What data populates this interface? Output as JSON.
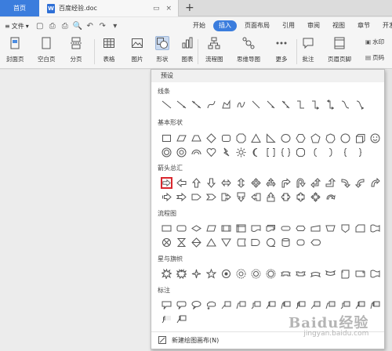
{
  "tabs": {
    "home": "首页",
    "doc": "百度经验.doc",
    "add": "+"
  },
  "menubar": {
    "file": "文件",
    "items": [
      {
        "label": "开始",
        "active": false
      },
      {
        "label": "插入",
        "active": true
      },
      {
        "label": "页面布局",
        "active": false
      },
      {
        "label": "引用",
        "active": false
      },
      {
        "label": "审阅",
        "active": false
      },
      {
        "label": "视图",
        "active": false
      },
      {
        "label": "章节",
        "active": false
      },
      {
        "label": "开发工具",
        "active": false
      }
    ]
  },
  "ribbon": {
    "cover": "封面页",
    "blank": "空白页",
    "pagebreak": "分页",
    "table": "表格",
    "picture": "图片",
    "shape": "形状",
    "chart": "图表",
    "flowchart": "流程图",
    "mindmap": "思维导图",
    "more": "更多",
    "comment": "批注",
    "headerfooter": "页眉页脚",
    "watermark": "水印",
    "pagenum": "页码"
  },
  "dropdown": {
    "preset": "预设",
    "sections": {
      "lines": "线条",
      "basic": "基本形状",
      "arrows": "箭头总汇",
      "flow": "流程图",
      "stars": "星与旗帜",
      "callouts": "标注"
    },
    "new_canvas": "新建绘图画布(N)"
  },
  "watermark_text": {
    "brand": "Baidu经验",
    "url": "jingyan.baidu.com"
  }
}
